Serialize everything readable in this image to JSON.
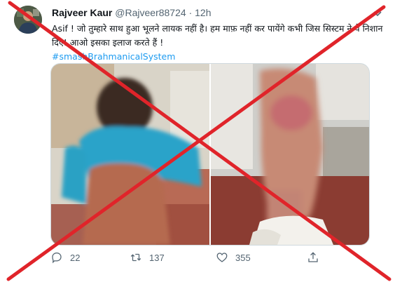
{
  "tweet": {
    "display_name": "Rajveer Kaur",
    "handle": "@Rajveer88724",
    "separator": "·",
    "time": "12h",
    "text": "Asif ! जो तुम्हारे साथ हुआ भूलने लायक नहीं है। हम माफ़ नहीं कर पायेंगे कभी जिस सिस्टम ने ये निशान दिए! आओ इसका इलाज करते हैं !",
    "hashtag": "#smashBrahmanicalSystem",
    "actions": {
      "reply_count": "22",
      "retweet_count": "137",
      "like_count": "355"
    }
  },
  "icons": {
    "more": "chevron-down-icon",
    "reply": "reply-icon",
    "retweet": "retweet-icon",
    "like": "heart-icon",
    "share": "share-icon"
  },
  "colors": {
    "accent": "#1d9bf0",
    "muted": "#536471",
    "cross_out": "#e0242a"
  }
}
